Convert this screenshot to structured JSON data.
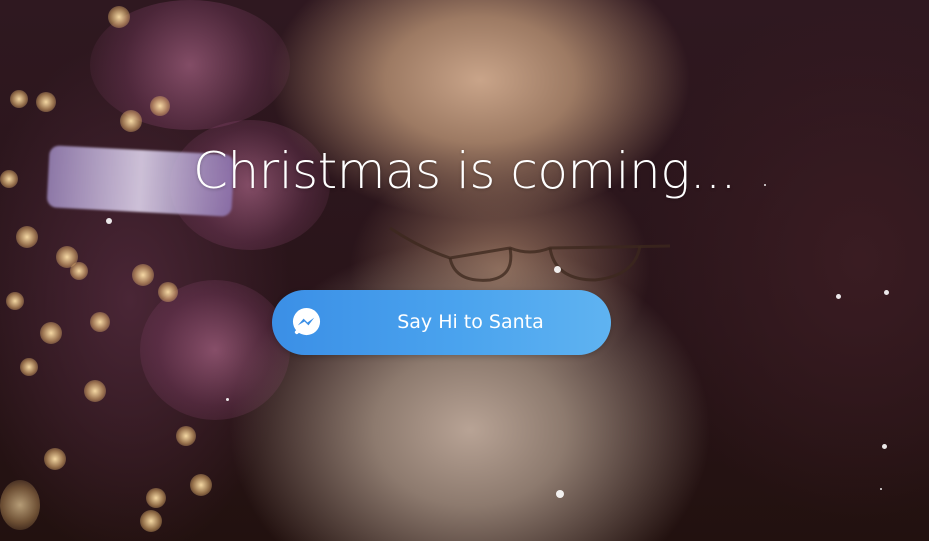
{
  "hero": {
    "title": "Christmas is coming...",
    "cta": {
      "label": "Say Hi to Santa",
      "icon": "messenger-icon",
      "gradient_start": "#3b8fe6",
      "gradient_end": "#5fb3f1"
    },
    "background": "santa-photo"
  }
}
